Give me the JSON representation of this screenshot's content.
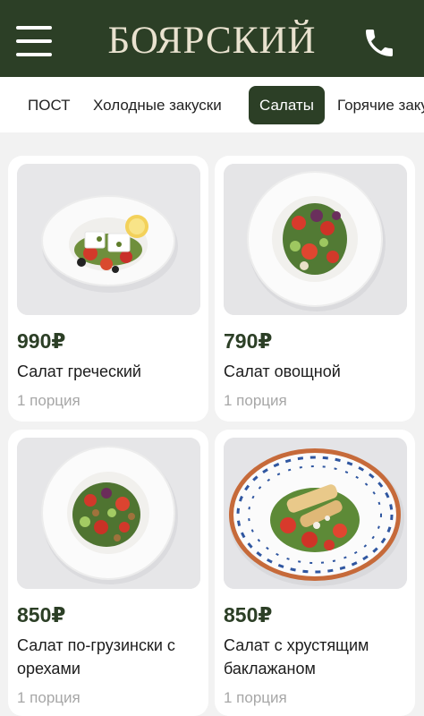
{
  "header": {
    "logo": "БОЯРСКИЙ",
    "menu_icon": "menu-icon",
    "phone_icon": "phone-icon",
    "colors": {
      "background": "#2c3f26",
      "logo": "#e9e2cf"
    }
  },
  "tabs": [
    {
      "label": "ПОСТ",
      "active": false
    },
    {
      "label": "Холодные закуски",
      "active": false
    },
    {
      "label": "Салаты",
      "active": true
    },
    {
      "label": "Горячие закуски",
      "active": false
    }
  ],
  "products": [
    {
      "price": "990₽",
      "name": "Салат греческий",
      "portion": "1 порция"
    },
    {
      "price": "790₽",
      "name": "Салат овощной",
      "portion": "1 порция"
    },
    {
      "price": "850₽",
      "name": "Салат по-грузински с орехами",
      "portion": "1 порция"
    },
    {
      "price": "850₽",
      "name": "Салат с хрустящим баклажаном",
      "portion": "1 порция"
    }
  ],
  "colors": {
    "accent": "#2c3f26",
    "muted_text": "#a7a7a7",
    "page_bg": "#f2f2f2"
  }
}
